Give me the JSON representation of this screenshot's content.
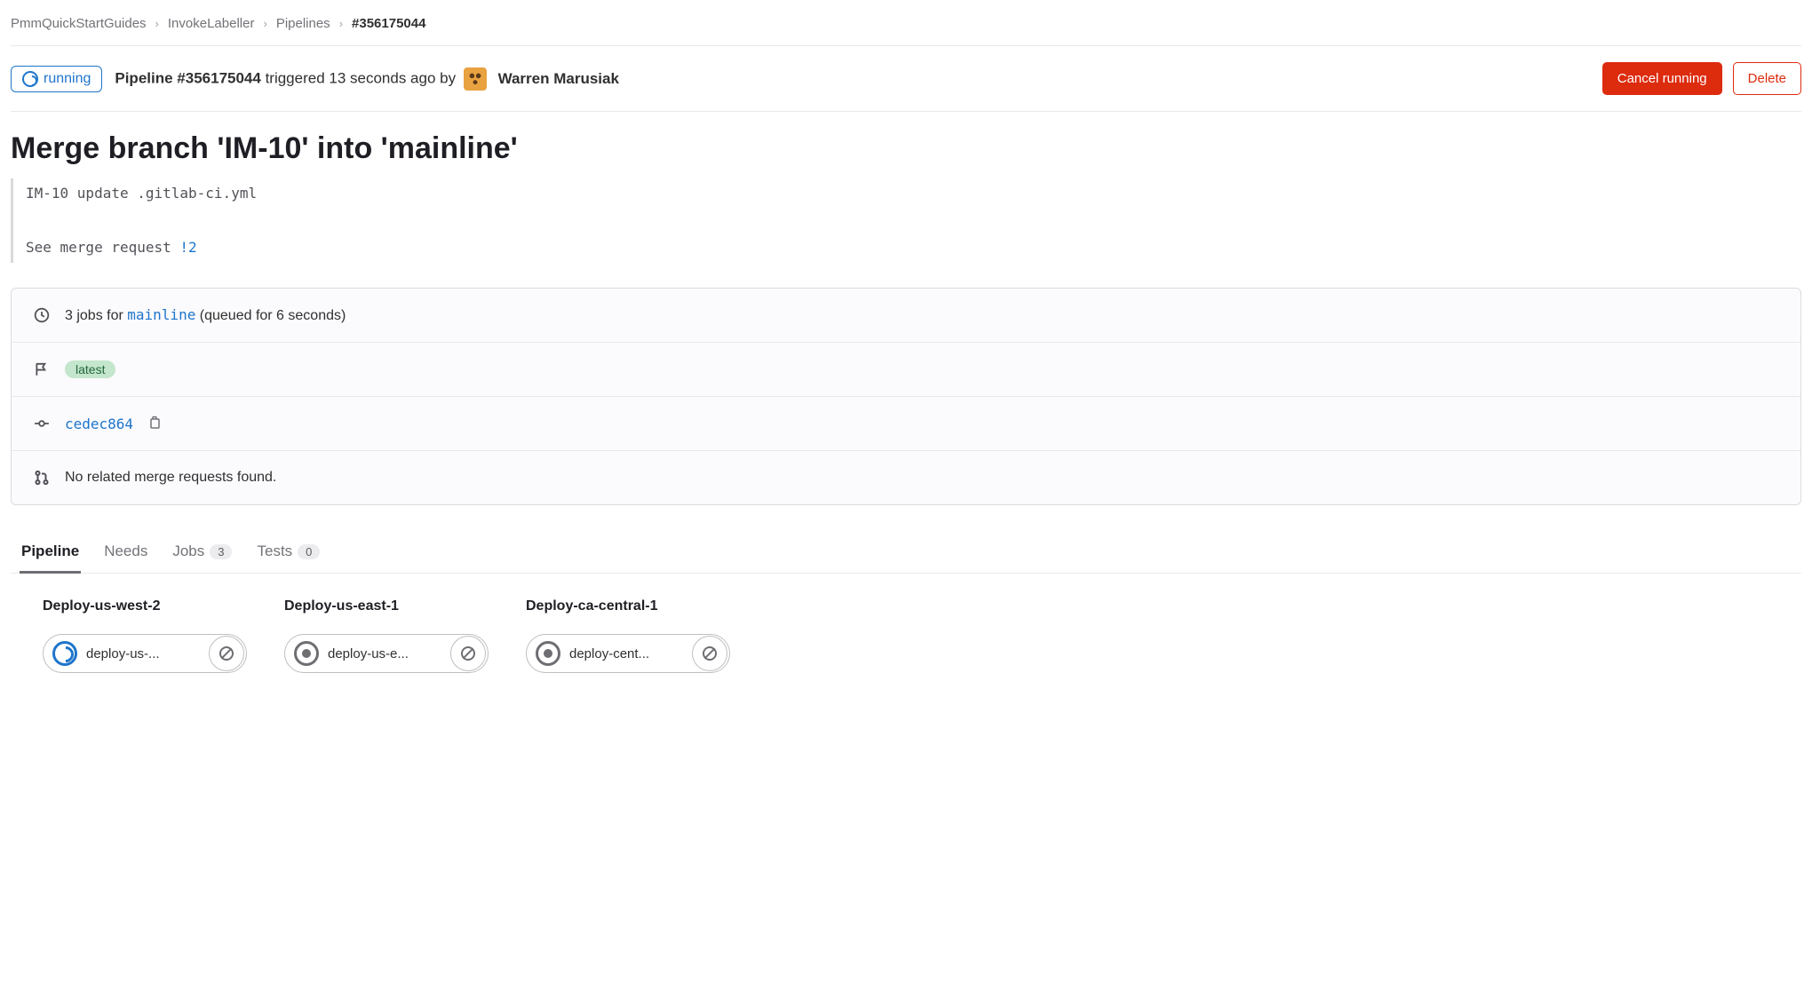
{
  "breadcrumbs": {
    "items": [
      {
        "label": "PmmQuickStartGuides"
      },
      {
        "label": "InvokeLabeller"
      },
      {
        "label": "Pipelines"
      },
      {
        "label": "#356175044"
      }
    ]
  },
  "header": {
    "status_label": "running",
    "pipeline_prefix": "Pipeline ",
    "pipeline_id": "#356175044",
    "trigger_text": " triggered 13 seconds ago by ",
    "author": "Warren Marusiak",
    "cancel_label": "Cancel running",
    "delete_label": "Delete"
  },
  "title": "Merge branch 'IM-10' into 'mainline'",
  "commit": {
    "line1": "IM-10 update .gitlab-ci.yml",
    "line2_prefix": "See merge request ",
    "mr_ref": "!2"
  },
  "info": {
    "jobs_prefix": "3 jobs for ",
    "branch": "mainline",
    "jobs_suffix": " (queued for 6 seconds)",
    "tag": "latest",
    "sha": "cedec864",
    "mr_text": "No related merge requests found."
  },
  "tabs": {
    "pipeline": "Pipeline",
    "needs": "Needs",
    "jobs": "Jobs",
    "jobs_count": "3",
    "tests": "Tests",
    "tests_count": "0"
  },
  "stages": [
    {
      "title": "Deploy-us-west-2",
      "job": "deploy-us-...",
      "status": "running"
    },
    {
      "title": "Deploy-us-east-1",
      "job": "deploy-us-e...",
      "status": "pending"
    },
    {
      "title": "Deploy-ca-central-1",
      "job": "deploy-cent...",
      "status": "pending"
    }
  ]
}
